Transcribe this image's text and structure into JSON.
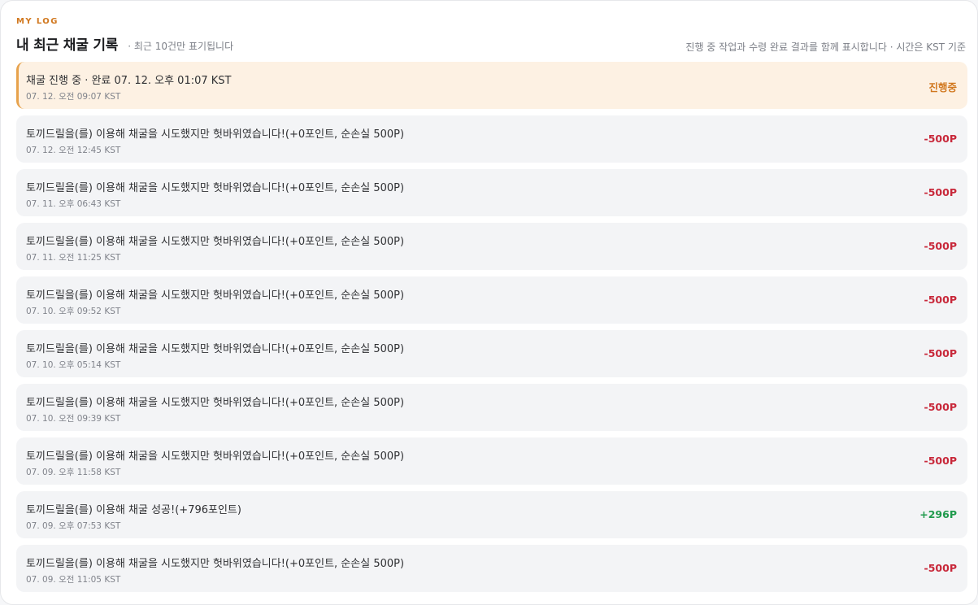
{
  "header": {
    "eyebrow": "MY LOG",
    "title": "내 최근 채굴 기록",
    "subtitle": "· 최근 10건만 표기됩니다",
    "note": "진행 중 작업과 수령 완료 결과를 함께 표시합니다 · 시간은 KST 기준"
  },
  "colors": {
    "accent": "#d1781f",
    "negative": "#c8283a",
    "positive": "#1f9a4c",
    "active_bg": "#fdf1e3"
  },
  "log": [
    {
      "message": "채굴 진행 중 · 완료 07. 12. 오후 01:07 KST",
      "time": "07. 12. 오전 09:07 KST",
      "amount": "진행중",
      "status": "pending"
    },
    {
      "message": "토끼드릴을(를) 이용해 채굴을 시도했지만 헛바위였습니다!(+0포인트, 순손실 500P)",
      "time": "07. 12. 오전 12:45 KST",
      "amount": "-500P",
      "status": "loss"
    },
    {
      "message": "토끼드릴을(를) 이용해 채굴을 시도했지만 헛바위였습니다!(+0포인트, 순손실 500P)",
      "time": "07. 11. 오후 06:43 KST",
      "amount": "-500P",
      "status": "loss"
    },
    {
      "message": "토끼드릴을(를) 이용해 채굴을 시도했지만 헛바위였습니다!(+0포인트, 순손실 500P)",
      "time": "07. 11. 오전 11:25 KST",
      "amount": "-500P",
      "status": "loss"
    },
    {
      "message": "토끼드릴을(를) 이용해 채굴을 시도했지만 헛바위였습니다!(+0포인트, 순손실 500P)",
      "time": "07. 10. 오후 09:52 KST",
      "amount": "-500P",
      "status": "loss"
    },
    {
      "message": "토끼드릴을(를) 이용해 채굴을 시도했지만 헛바위였습니다!(+0포인트, 순손실 500P)",
      "time": "07. 10. 오후 05:14 KST",
      "amount": "-500P",
      "status": "loss"
    },
    {
      "message": "토끼드릴을(를) 이용해 채굴을 시도했지만 헛바위였습니다!(+0포인트, 순손실 500P)",
      "time": "07. 10. 오전 09:39 KST",
      "amount": "-500P",
      "status": "loss"
    },
    {
      "message": "토끼드릴을(를) 이용해 채굴을 시도했지만 헛바위였습니다!(+0포인트, 순손실 500P)",
      "time": "07. 09. 오후 11:58 KST",
      "amount": "-500P",
      "status": "loss"
    },
    {
      "message": "토끼드릴을(를) 이용해 채굴 성공!(+796포인트)",
      "time": "07. 09. 오후 07:53 KST",
      "amount": "+296P",
      "status": "gain"
    },
    {
      "message": "토끼드릴을(를) 이용해 채굴을 시도했지만 헛바위였습니다!(+0포인트, 순손실 500P)",
      "time": "07. 09. 오전 11:05 KST",
      "amount": "-500P",
      "status": "loss"
    }
  ]
}
